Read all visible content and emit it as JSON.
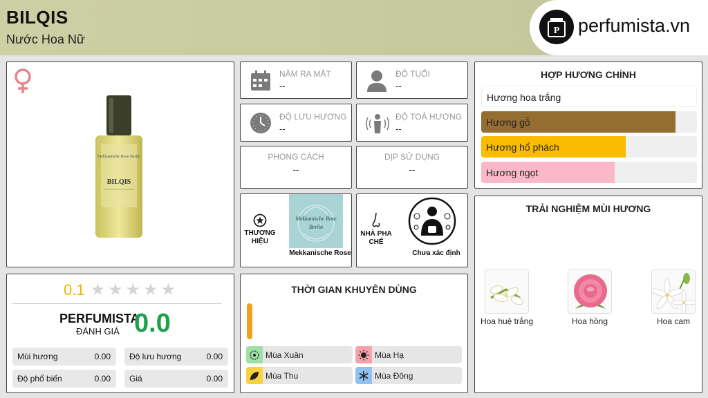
{
  "header": {
    "title": "BILQIS",
    "subtitle": "Nước Hoa Nữ",
    "logo_text": "perfumista.vn"
  },
  "product": {
    "gender_icon": "female-symbol-icon",
    "bottle_brand_text": "Mekkanische Rose Berlin",
    "bottle_name_text": "BILQIS"
  },
  "rating": {
    "score": "0.1",
    "stars_total": 5,
    "stars_filled": 0,
    "perfumista_label": "PERFUMISTA",
    "perfumista_sub": "ĐÁNH GIÁ",
    "perfumista_score": "0.0",
    "metrics": [
      {
        "label": "Mùi hương",
        "value": "0.00"
      },
      {
        "label": "Độ lưu hương",
        "value": "0.00"
      },
      {
        "label": "Độ phổ biến",
        "value": "0.00"
      },
      {
        "label": "Giá",
        "value": "0.00"
      }
    ]
  },
  "info": {
    "release_year": {
      "label": "NĂM RA MẮT",
      "value": "--",
      "icon": "calendar-icon"
    },
    "age": {
      "label": "ĐỘ TUỔI",
      "value": "--",
      "icon": "person-icon"
    },
    "longevity": {
      "label": "ĐỘ LƯU HƯƠNG",
      "value": "--",
      "icon": "clock-icon"
    },
    "sillage": {
      "label": "ĐỘ TOẢ HƯƠNG",
      "value": "--",
      "icon": "sillage-icon"
    },
    "style": {
      "label": "PHONG CÁCH",
      "value": "--"
    },
    "occasion": {
      "label": "DỊP SỬ DỤNG",
      "value": "--"
    }
  },
  "brand": {
    "caption": "THƯƠNG HIỆU",
    "name": "Mekkanische Rose",
    "logo_line1": "Mekkanische Rose",
    "logo_line2": "Berlin"
  },
  "perfumer": {
    "caption": "NHÀ PHA CHẾ",
    "name": "Chưa xác định"
  },
  "accords": {
    "title": "HỢP HƯƠNG CHÍNH",
    "items": [
      {
        "label": "Hương hoa trắng",
        "percent": 100,
        "color": "#ffffff"
      },
      {
        "label": "Hương gỗ",
        "percent": 90,
        "color": "#956d31"
      },
      {
        "label": "Hương hổ phách",
        "percent": 67,
        "color": "#fbbb00"
      },
      {
        "label": "Hương ngọt",
        "percent": 62,
        "color": "#fbb8c8"
      }
    ]
  },
  "usage": {
    "title": "THỜI GIAN KHUYÊN DÙNG",
    "bar_color": "#f0a21c",
    "seasons": [
      {
        "label": "Mùa Xuân",
        "color": "#9ee0a6",
        "icon": "spring-icon"
      },
      {
        "label": "Mùa Hạ",
        "color": "#f7a1ad",
        "icon": "sun-icon"
      },
      {
        "label": "Mùa Thu",
        "color": "#f6d23c",
        "icon": "leaf-icon"
      },
      {
        "label": "Mùa Đông",
        "color": "#8fc2f0",
        "icon": "snowflake-icon"
      }
    ]
  },
  "notes": {
    "title": "TRẢI NGHIỆM MÙI HƯƠNG",
    "items": [
      {
        "label": "Hoa huệ trắng",
        "icon": "tuberose-icon"
      },
      {
        "label": "Hoa hồng",
        "icon": "rose-icon"
      },
      {
        "label": "Hoa cam",
        "icon": "orange-blossom-icon"
      }
    ]
  }
}
